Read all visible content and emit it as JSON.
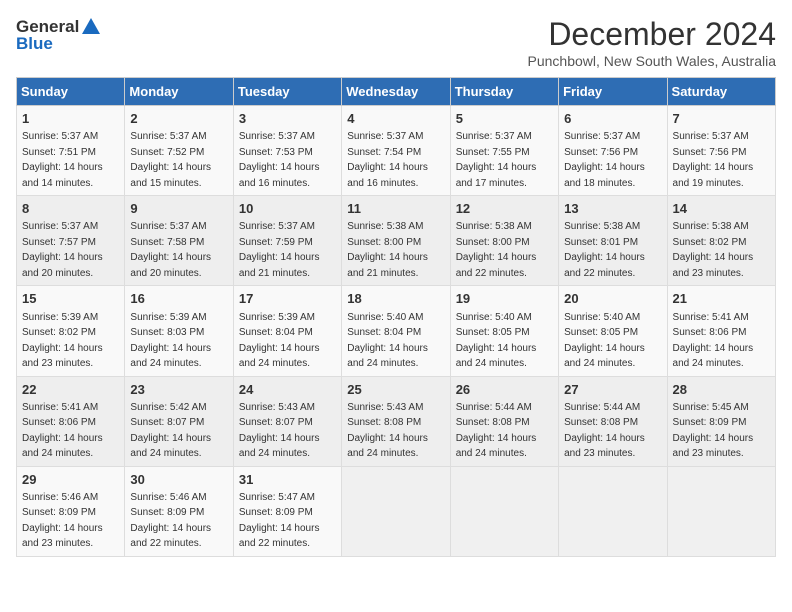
{
  "header": {
    "logo_general": "General",
    "logo_blue": "Blue",
    "main_title": "December 2024",
    "subtitle": "Punchbowl, New South Wales, Australia"
  },
  "calendar": {
    "days_of_week": [
      "Sunday",
      "Monday",
      "Tuesday",
      "Wednesday",
      "Thursday",
      "Friday",
      "Saturday"
    ],
    "weeks": [
      [
        {
          "day": "",
          "detail": ""
        },
        {
          "day": "2",
          "detail": "Sunrise: 5:37 AM\nSunset: 7:52 PM\nDaylight: 14 hours\nand 15 minutes."
        },
        {
          "day": "3",
          "detail": "Sunrise: 5:37 AM\nSunset: 7:53 PM\nDaylight: 14 hours\nand 16 minutes."
        },
        {
          "day": "4",
          "detail": "Sunrise: 5:37 AM\nSunset: 7:54 PM\nDaylight: 14 hours\nand 16 minutes."
        },
        {
          "day": "5",
          "detail": "Sunrise: 5:37 AM\nSunset: 7:55 PM\nDaylight: 14 hours\nand 17 minutes."
        },
        {
          "day": "6",
          "detail": "Sunrise: 5:37 AM\nSunset: 7:56 PM\nDaylight: 14 hours\nand 18 minutes."
        },
        {
          "day": "7",
          "detail": "Sunrise: 5:37 AM\nSunset: 7:56 PM\nDaylight: 14 hours\nand 19 minutes."
        }
      ],
      [
        {
          "day": "8",
          "detail": "Sunrise: 5:37 AM\nSunset: 7:57 PM\nDaylight: 14 hours\nand 20 minutes."
        },
        {
          "day": "9",
          "detail": "Sunrise: 5:37 AM\nSunset: 7:58 PM\nDaylight: 14 hours\nand 20 minutes."
        },
        {
          "day": "10",
          "detail": "Sunrise: 5:37 AM\nSunset: 7:59 PM\nDaylight: 14 hours\nand 21 minutes."
        },
        {
          "day": "11",
          "detail": "Sunrise: 5:38 AM\nSunset: 8:00 PM\nDaylight: 14 hours\nand 21 minutes."
        },
        {
          "day": "12",
          "detail": "Sunrise: 5:38 AM\nSunset: 8:00 PM\nDaylight: 14 hours\nand 22 minutes."
        },
        {
          "day": "13",
          "detail": "Sunrise: 5:38 AM\nSunset: 8:01 PM\nDaylight: 14 hours\nand 22 minutes."
        },
        {
          "day": "14",
          "detail": "Sunrise: 5:38 AM\nSunset: 8:02 PM\nDaylight: 14 hours\nand 23 minutes."
        }
      ],
      [
        {
          "day": "15",
          "detail": "Sunrise: 5:39 AM\nSunset: 8:02 PM\nDaylight: 14 hours\nand 23 minutes."
        },
        {
          "day": "16",
          "detail": "Sunrise: 5:39 AM\nSunset: 8:03 PM\nDaylight: 14 hours\nand 24 minutes."
        },
        {
          "day": "17",
          "detail": "Sunrise: 5:39 AM\nSunset: 8:04 PM\nDaylight: 14 hours\nand 24 minutes."
        },
        {
          "day": "18",
          "detail": "Sunrise: 5:40 AM\nSunset: 8:04 PM\nDaylight: 14 hours\nand 24 minutes."
        },
        {
          "day": "19",
          "detail": "Sunrise: 5:40 AM\nSunset: 8:05 PM\nDaylight: 14 hours\nand 24 minutes."
        },
        {
          "day": "20",
          "detail": "Sunrise: 5:40 AM\nSunset: 8:05 PM\nDaylight: 14 hours\nand 24 minutes."
        },
        {
          "day": "21",
          "detail": "Sunrise: 5:41 AM\nSunset: 8:06 PM\nDaylight: 14 hours\nand 24 minutes."
        }
      ],
      [
        {
          "day": "22",
          "detail": "Sunrise: 5:41 AM\nSunset: 8:06 PM\nDaylight: 14 hours\nand 24 minutes."
        },
        {
          "day": "23",
          "detail": "Sunrise: 5:42 AM\nSunset: 8:07 PM\nDaylight: 14 hours\nand 24 minutes."
        },
        {
          "day": "24",
          "detail": "Sunrise: 5:43 AM\nSunset: 8:07 PM\nDaylight: 14 hours\nand 24 minutes."
        },
        {
          "day": "25",
          "detail": "Sunrise: 5:43 AM\nSunset: 8:08 PM\nDaylight: 14 hours\nand 24 minutes."
        },
        {
          "day": "26",
          "detail": "Sunrise: 5:44 AM\nSunset: 8:08 PM\nDaylight: 14 hours\nand 24 minutes."
        },
        {
          "day": "27",
          "detail": "Sunrise: 5:44 AM\nSunset: 8:08 PM\nDaylight: 14 hours\nand 23 minutes."
        },
        {
          "day": "28",
          "detail": "Sunrise: 5:45 AM\nSunset: 8:09 PM\nDaylight: 14 hours\nand 23 minutes."
        }
      ],
      [
        {
          "day": "29",
          "detail": "Sunrise: 5:46 AM\nSunset: 8:09 PM\nDaylight: 14 hours\nand 23 minutes."
        },
        {
          "day": "30",
          "detail": "Sunrise: 5:46 AM\nSunset: 8:09 PM\nDaylight: 14 hours\nand 22 minutes."
        },
        {
          "day": "31",
          "detail": "Sunrise: 5:47 AM\nSunset: 8:09 PM\nDaylight: 14 hours\nand 22 minutes."
        },
        {
          "day": "",
          "detail": ""
        },
        {
          "day": "",
          "detail": ""
        },
        {
          "day": "",
          "detail": ""
        },
        {
          "day": "",
          "detail": ""
        }
      ]
    ],
    "week1_sun": {
      "day": "1",
      "detail": "Sunrise: 5:37 AM\nSunset: 7:51 PM\nDaylight: 14 hours\nand 14 minutes."
    }
  }
}
